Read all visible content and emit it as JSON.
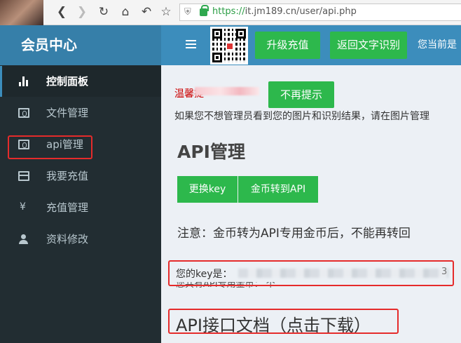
{
  "browser": {
    "url_scheme": "https://",
    "url_rest": "it.jm189.cn/user/api.php",
    "icons": [
      "back-icon",
      "forward-icon",
      "reload-icon",
      "home-icon",
      "undo-icon",
      "star-icon",
      "shield-icon",
      "lock-icon"
    ]
  },
  "sidebar": {
    "brand": "会员中心",
    "items": [
      {
        "label": "控制面板",
        "icon": "bar-chart-icon"
      },
      {
        "label": "文件管理",
        "icon": "money-icon"
      },
      {
        "label": "api管理",
        "icon": "money-icon"
      },
      {
        "label": "我要充值",
        "icon": "credit-card-icon"
      },
      {
        "label": "充值管理",
        "icon": "yen-icon"
      },
      {
        "label": "资料修改",
        "icon": "user-icon"
      }
    ]
  },
  "topbar": {
    "menu_icon": "menu-toggle-icon",
    "upgrade_label": "升级充值",
    "back_label": "返回文字识别",
    "status_text": "您当前是"
  },
  "content": {
    "tip_label": "温馨提",
    "tip_dismiss_label": "不再提示",
    "tip_text": "如果您不想管理员看到您的图片和识别结果，请在图片管理",
    "page_title": "API管理",
    "change_key_label": "更换key",
    "transfer_label": "金币转到API",
    "notice": "注意：金币转为API专用金币后，不能再转回",
    "key_label": "您的key是：",
    "key_tail": "3",
    "balance_text": "您共有API专用金币： 个",
    "doc_link": "API接口文档（点击下载）"
  },
  "colors": {
    "sidebar_bg": "#222d32",
    "brand_bg": "#367fa9",
    "topbar_bg": "#3c8dbc",
    "button_green": "#2db84c",
    "annotation_red": "#e52b2b"
  }
}
